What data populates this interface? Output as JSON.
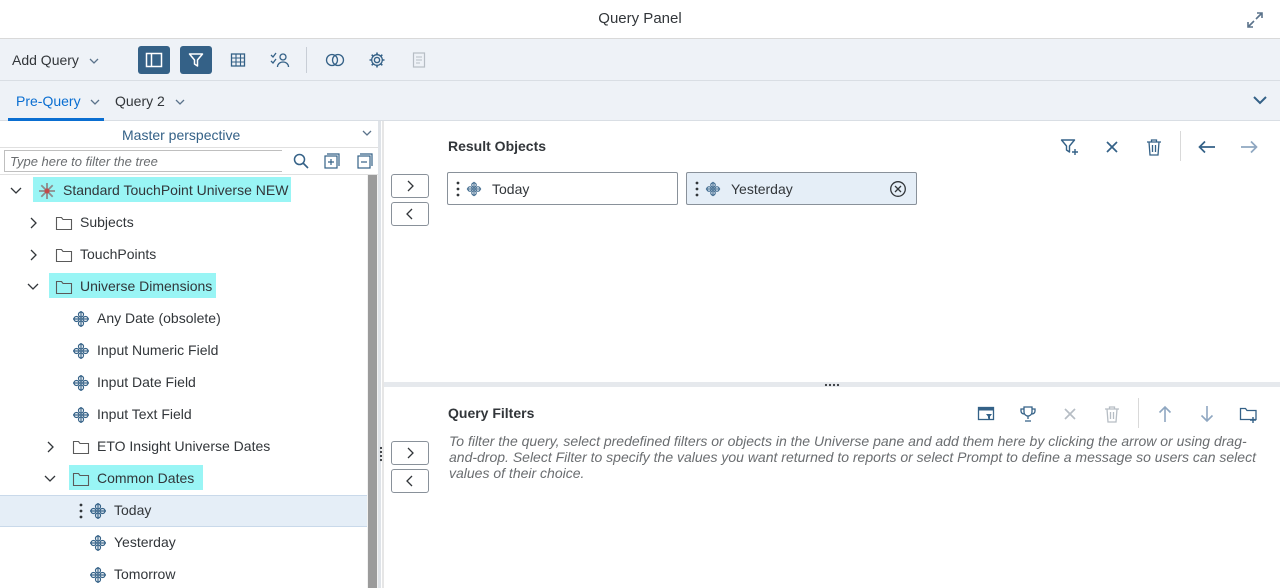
{
  "window": {
    "title": "Query Panel"
  },
  "toolbar": {
    "add_query_label": "Add Query",
    "buttons": [
      {
        "icon": "panel-toggle-icon",
        "active": true
      },
      {
        "icon": "filter-icon",
        "active": true
      },
      {
        "icon": "table-icon",
        "active": false
      },
      {
        "icon": "user-check-icon",
        "active": false
      },
      {
        "icon": "combined-query-icon",
        "active": false
      },
      {
        "icon": "gear-icon",
        "active": false
      },
      {
        "icon": "document-icon",
        "active": false,
        "disabled": true
      }
    ]
  },
  "tabs": [
    {
      "label": "Pre-Query",
      "active": true
    },
    {
      "label": "Query 2",
      "active": false
    }
  ],
  "tree_panel": {
    "perspective": "Master perspective",
    "filter_placeholder": "Type here to filter the tree",
    "items": [
      {
        "label": "Standard TouchPoint Universe NEW",
        "type": "universe",
        "expanded": true,
        "highlight": true
      },
      {
        "label": "Subjects",
        "type": "folder",
        "expanded": false
      },
      {
        "label": "TouchPoints",
        "type": "folder",
        "expanded": false
      },
      {
        "label": "Universe Dimensions",
        "type": "folder",
        "expanded": true,
        "highlight": true
      },
      {
        "label": "Any Date (obsolete)",
        "type": "dimension"
      },
      {
        "label": "Input Numeric Field",
        "type": "dimension"
      },
      {
        "label": "Input Date Field",
        "type": "dimension"
      },
      {
        "label": "Input Text Field",
        "type": "dimension"
      },
      {
        "label": "ETO Insight Universe Dates",
        "type": "folder",
        "expanded": false
      },
      {
        "label": "Common Dates",
        "type": "folder",
        "expanded": true,
        "highlight": true
      },
      {
        "label": "Today",
        "type": "dimension",
        "selected": true
      },
      {
        "label": "Yesterday",
        "type": "dimension"
      },
      {
        "label": "Tomorrow",
        "type": "dimension"
      }
    ]
  },
  "result_objects": {
    "title": "Result Objects",
    "tokens": [
      {
        "label": "Today",
        "selected": false
      },
      {
        "label": "Yesterday",
        "selected": true
      }
    ]
  },
  "query_filters": {
    "title": "Query Filters",
    "hint": "To filter the query, select predefined filters or objects in the Universe pane and add them here by clicking the arrow or using drag-and-drop. Select Filter to specify the values you want returned to reports or select Prompt to define a message so users can select values of their choice."
  },
  "colors": {
    "accent": "#0a6ed1",
    "toolbar_bg": "#eef2f7",
    "active_button": "#346187",
    "highlight": "#99f5f5",
    "selected_row": "#e5eef7"
  }
}
